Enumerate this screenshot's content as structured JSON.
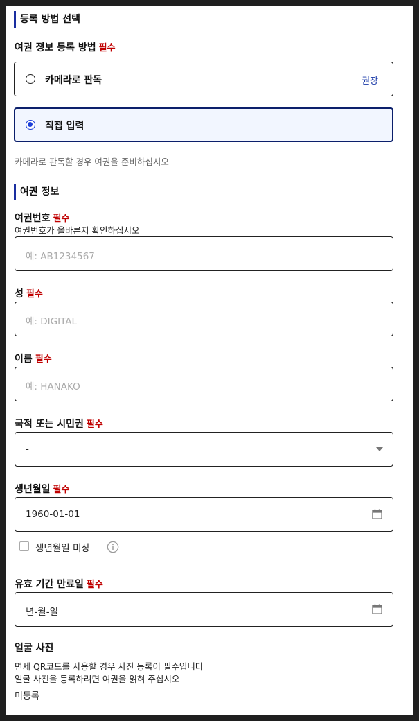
{
  "registration": {
    "section_title": "등록 방법 선택",
    "field_label": "여권 정보 등록 방법",
    "required": "필수",
    "options": [
      {
        "label": "카메라로 판독",
        "tag": "권장",
        "selected": false
      },
      {
        "label": "직접 입력",
        "tag": "",
        "selected": true
      }
    ],
    "note": "카메라로 판독할 경우 여권을 준비하십시오"
  },
  "passport": {
    "section_title": "여권 정보",
    "number": {
      "label": "여권번호",
      "required": "필수",
      "help": "여권번호가 올바른지 확인하십시오",
      "placeholder": "예: AB1234567"
    },
    "surname": {
      "label": "성",
      "required": "필수",
      "placeholder": "예: DIGITAL"
    },
    "given_name": {
      "label": "이름",
      "required": "필수",
      "placeholder": "예: HANAKO"
    },
    "nationality": {
      "label": "국적 또는 시민권",
      "required": "필수",
      "value": "-"
    },
    "birthdate": {
      "label": "생년월일",
      "required": "필수",
      "value": "1960-01-01",
      "unknown_label": "생년월일 미상"
    },
    "expiry": {
      "label": "유효 기간 만료일",
      "required": "필수",
      "value": "년-월-일"
    },
    "photo": {
      "label": "얼굴 사진",
      "help_line1": "면세 QR코드를 사용할 경우 사진 등록이 필수입니다",
      "help_line2": "얼굴 사진을 등록하려면 여권을 읽혀 주십시오",
      "status": "미등록"
    }
  },
  "icons": {
    "calendar": "calendar-icon",
    "info": "info-icon",
    "dropdown": "chevron-down-icon"
  },
  "colors": {
    "accent": "#1a2ea0",
    "required": "#c00000",
    "radio": "#1d3fd8",
    "selected_bg": "#f2f6ff"
  }
}
